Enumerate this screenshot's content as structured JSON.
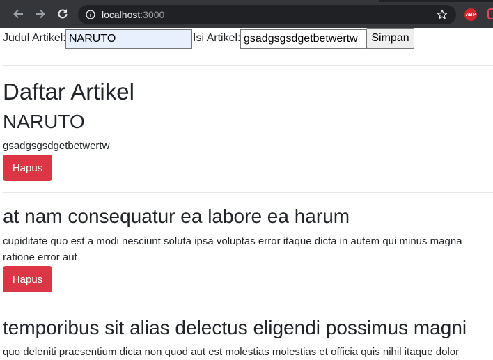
{
  "browser": {
    "url_host": "localhost",
    "url_port": ":3000",
    "abp_label": "ABP"
  },
  "form": {
    "judul_label": "Judul Artikel:",
    "judul_value": "NARUTO",
    "isi_label": "Isi Artikel:",
    "isi_value": "gsadgsgsdgetbetwertw",
    "submit_label": "Simpan"
  },
  "heading": "Daftar Artikel",
  "articles": [
    {
      "title": "NARUTO",
      "body": [
        "gsadgsgsdgetbetwertw"
      ],
      "delete_label": "Hapus"
    },
    {
      "title": "at nam consequatur ea labore ea harum",
      "body": [
        "cupiditate quo est a modi nesciunt soluta ipsa voluptas error itaque dicta in autem qui minus magna",
        "ratione error aut"
      ],
      "delete_label": "Hapus"
    },
    {
      "title": "temporibus sit alias delectus eligendi possimus magni",
      "body": [
        "quo deleniti praesentium dicta non quod aut est molestias molestias et officia quis nihil itaque dolor"
      ]
    }
  ],
  "colors": {
    "danger": "#dc3545",
    "autofill": "#e8f0fe",
    "chrome": "#35363a"
  }
}
